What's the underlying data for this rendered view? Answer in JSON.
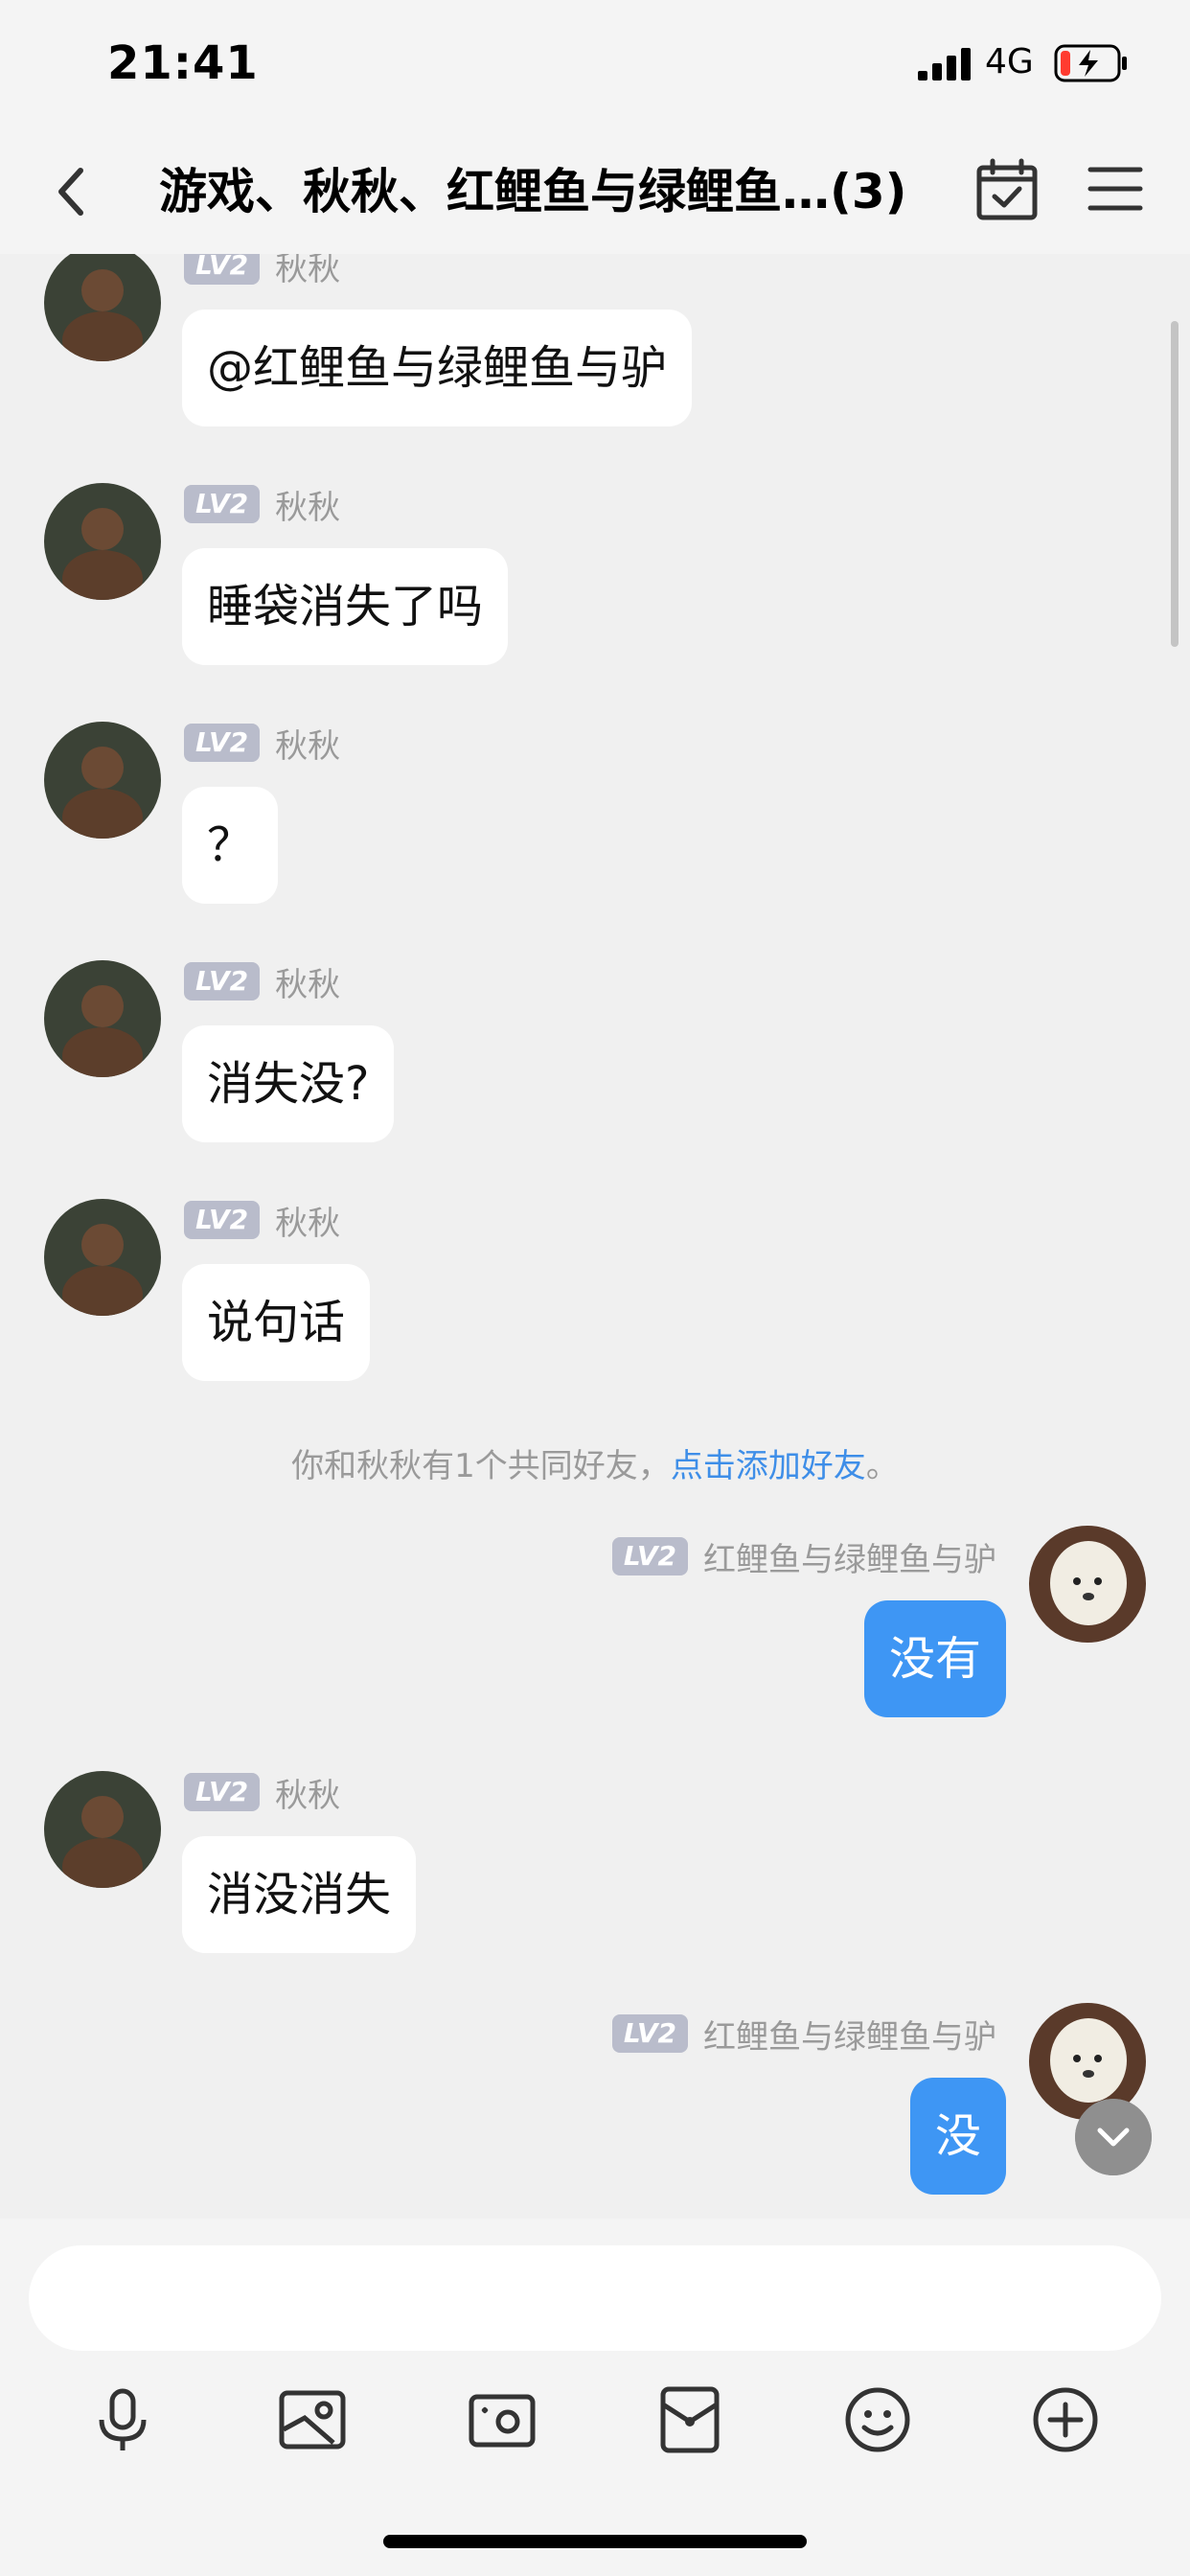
{
  "status": {
    "time": "21:41",
    "network": "4G"
  },
  "header": {
    "title": "游戏、秋秋、红鲤鱼与绿鲤鱼…(3)"
  },
  "users": {
    "qiuqiu": {
      "level": "LV2",
      "name": "秋秋"
    },
    "me": {
      "level": "LV2",
      "name": "红鲤鱼与绿鲤鱼与驴"
    }
  },
  "messages": [
    {
      "text": "@红鲤鱼与绿鲤鱼与驴"
    },
    {
      "text": "睡袋消失了吗"
    },
    {
      "text": "？"
    },
    {
      "text": "消失没?"
    },
    {
      "text": "说句话"
    },
    {
      "text": "没有"
    },
    {
      "text": "消没消失"
    },
    {
      "text": "没"
    }
  ],
  "system_notice": {
    "text": "你和秋秋有1个共同好友，",
    "link": "点击添加好友",
    "suffix": "。"
  },
  "input": {
    "placeholder": ""
  },
  "toolbar": [
    "microphone-icon",
    "image-icon",
    "camera-icon",
    "red-packet-icon",
    "emoji-icon",
    "plus-icon"
  ],
  "colors": {
    "outgoing_bubble": "#3e96f4",
    "incoming_bubble": "#ffffff",
    "link": "#3e8ee8",
    "level_badge": "#b9bccb"
  }
}
